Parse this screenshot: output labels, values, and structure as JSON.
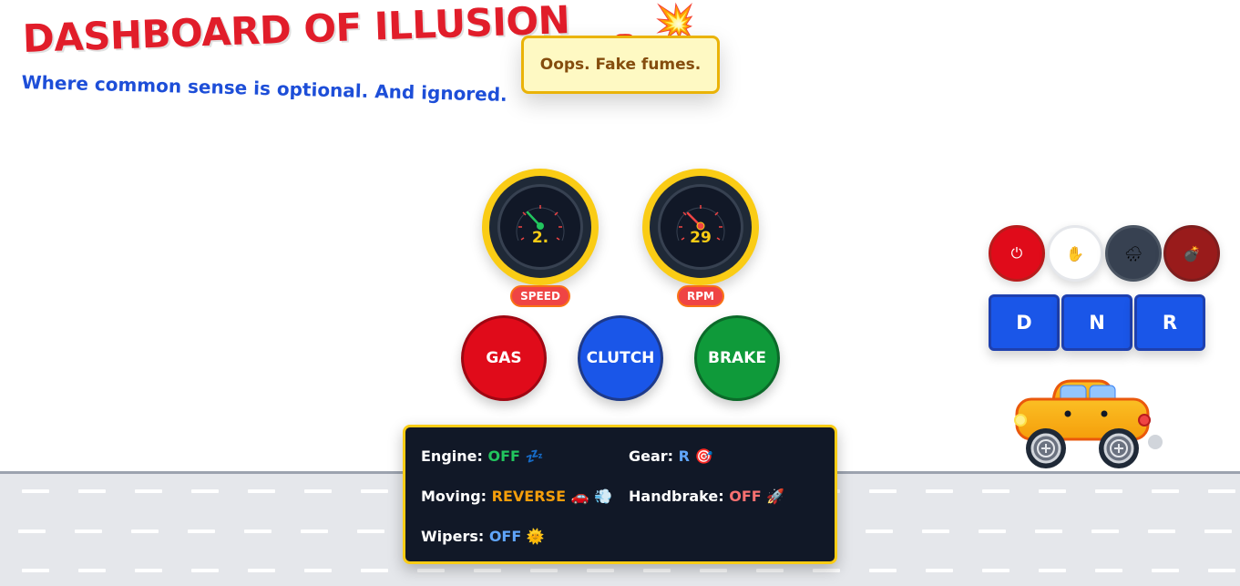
{
  "header": {
    "title": "DASHBOARD OF ILLUSION",
    "subtitle": "Where common sense is optional. And ignored.",
    "emoji_car": "🚗",
    "emoji_boom": "💥"
  },
  "toast": {
    "message": "Oops. Fake fumes."
  },
  "gauges": {
    "speed": {
      "value": "2.",
      "label": "SPEED"
    },
    "rpm": {
      "value": "29",
      "label": "RPM"
    }
  },
  "pedals": {
    "gas": "GAS",
    "clutch": "CLUTCH",
    "brake": "BRAKE"
  },
  "controls": {
    "power_icon": "⏻",
    "hand_icon": "✋",
    "wiper_icon": "🌧",
    "horn_icon": "💣"
  },
  "gears": {
    "drive": "D",
    "neutral": "N",
    "reverse": "R"
  },
  "status": {
    "engine_label": "Engine:",
    "engine_value": "OFF",
    "engine_emoji": "💤",
    "gear_label": "Gear:",
    "gear_value": "R",
    "gear_emoji": "🎯",
    "moving_label": "Moving:",
    "moving_value": "REVERSE",
    "moving_emoji": "🚗 💨",
    "handbrake_label": "Handbrake:",
    "handbrake_value": "OFF",
    "handbrake_emoji": "🚀",
    "wipers_label": "Wipers:",
    "wipers_value": "OFF",
    "wipers_emoji": "🌞"
  },
  "colors": {
    "title": "#e11d2a",
    "subtitle": "#1d4ed8",
    "gauge_ring": "#facc15",
    "gas": "#e00b1a",
    "clutch": "#1a56e8",
    "brake": "#0f9a3a",
    "car_body": "#f59e0b",
    "status_bg": "#111827"
  }
}
